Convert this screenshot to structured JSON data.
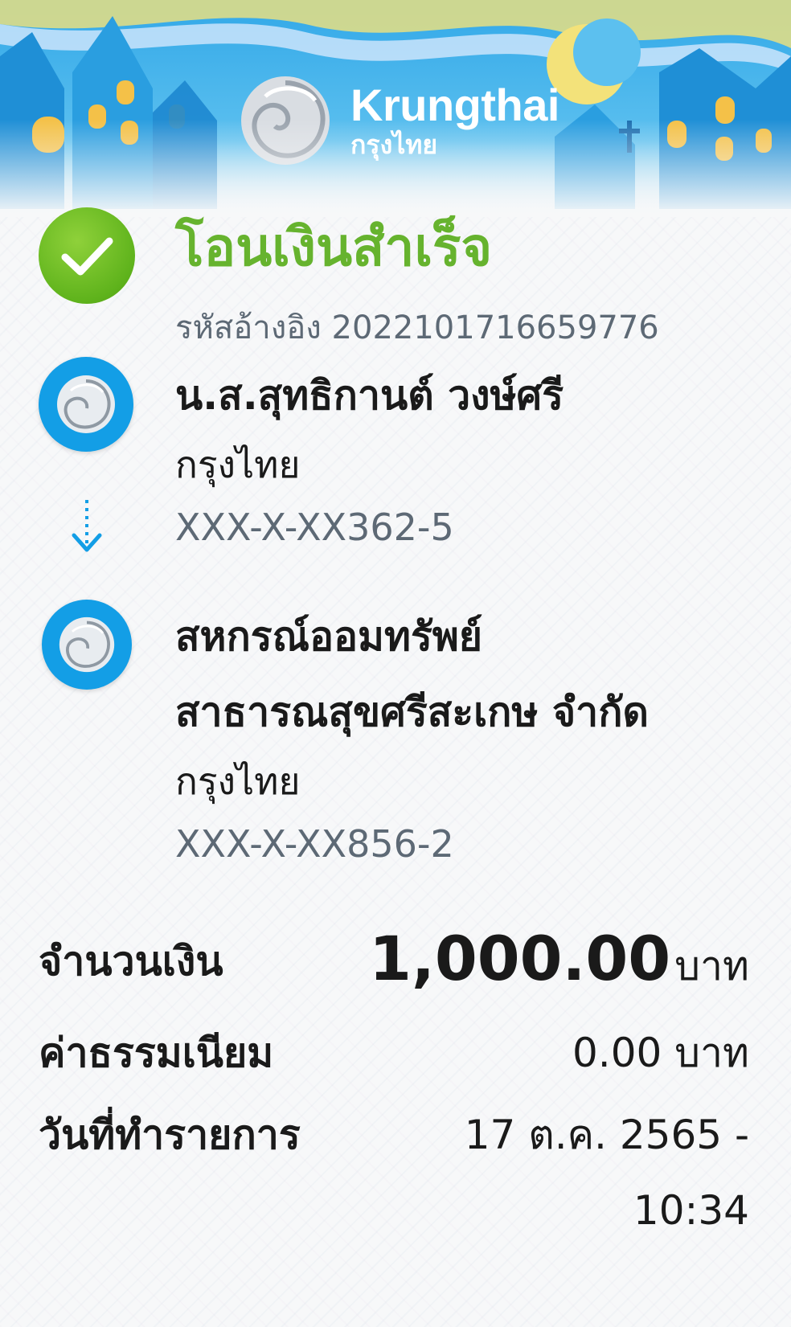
{
  "brand": {
    "name_en": "Krungthai",
    "name_th": "กรุงไทย"
  },
  "status": {
    "title": "โอนเงินสำเร็จ",
    "icon": "check-icon",
    "color": "#66b32e"
  },
  "reference": {
    "label": "รหัสอ้างอิง",
    "value": "2022101716659776",
    "display": "รหัสอ้างอิง 2022101716659776"
  },
  "sender": {
    "name": "น.ส.สุทธิกานต์ วงษ์ศรี",
    "bank": "กรุงไทย",
    "account": "XXX-X-XX362-5",
    "icon": "krungthai-logo-icon"
  },
  "receiver": {
    "name_line1": "สหกรณ์ออมทรัพย์",
    "name_line2": "สาธารณสุขศรีสะเกษ จำกัด",
    "bank": "กรุงไทย",
    "account": "XXX-X-XX856-2",
    "icon": "krungthai-logo-icon"
  },
  "details": {
    "amount_label": "จำนวนเงิน",
    "amount_value": "1,000.00",
    "amount_unit": "บาท",
    "fee_label": "ค่าธรรมเนียม",
    "fee_value": "0.00 บาท",
    "date_label": "วันที่ทำรายการ",
    "date_value": "17 ต.ค. 2565 -",
    "time_value": "10:34"
  },
  "colors": {
    "brand_blue": "#139ee6",
    "success_green": "#66b32e",
    "muted_text": "#5d6975"
  }
}
